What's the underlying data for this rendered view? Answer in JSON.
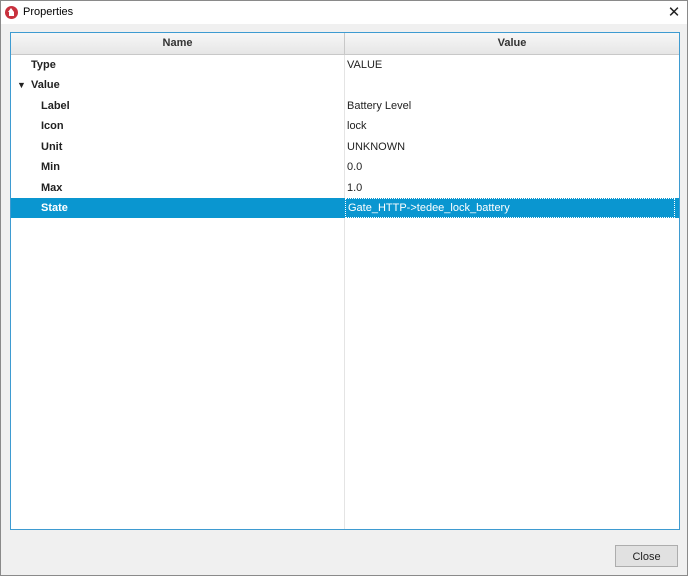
{
  "window": {
    "title": "Properties",
    "close_glyph": "✕"
  },
  "table": {
    "columns": {
      "name": "Name",
      "value": "Value"
    },
    "rows": [
      {
        "name": "Type",
        "value": "VALUE"
      },
      {
        "name": "Value",
        "value": "",
        "toggle": "▼"
      },
      {
        "name": "Label",
        "value": "Battery Level"
      },
      {
        "name": "Icon",
        "value": "lock"
      },
      {
        "name": "Unit",
        "value": "UNKNOWN"
      },
      {
        "name": "Min",
        "value": "0.0"
      },
      {
        "name": "Max",
        "value": "1.0"
      },
      {
        "name": "State",
        "value": "Gate_HTTP->tedee_lock_battery"
      }
    ]
  },
  "footer": {
    "close_label": "Close"
  },
  "colors": {
    "selection": "#0a96d0",
    "focus_border": "#3e9bd1",
    "app_icon": "#c8313e"
  },
  "icons": {
    "app": "home-icon",
    "close": "close-icon",
    "expand": "chevron-down-icon"
  }
}
